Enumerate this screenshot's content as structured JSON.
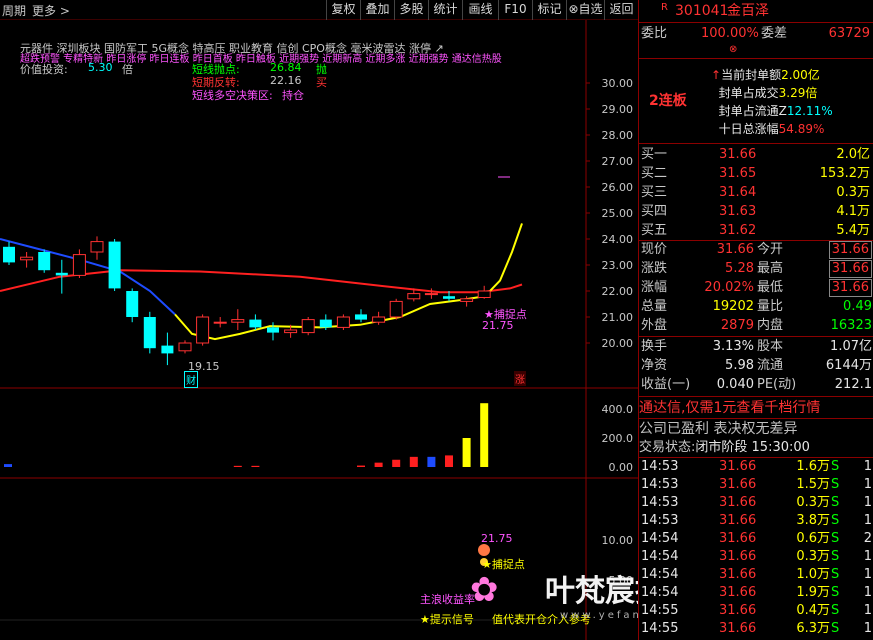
{
  "toolbar": {
    "left_items": [
      "周期",
      "更多 >"
    ],
    "buttons": [
      "复权",
      "叠加",
      "多股",
      "统计",
      "画线",
      "F10",
      "标记",
      "自选",
      "返回"
    ]
  },
  "stock": {
    "code": "301041",
    "name": "金百泽",
    "label_R": "R"
  },
  "chart": {
    "concepts_line": "元器件  深圳板块  国防军工 5G概念 特高压 职业教育 信创 CPO概念 毫米波雷达 涨停  ↗",
    "signals_line": "超跌预警 专精特新 昨日涨停 昨日连板 昨日首板 昨日触板 近期强势 近期新高 近期多涨 近期强势 通达信热股",
    "value_invest_label": "价值投资:",
    "value_invest_value": "5.30",
    "value_invest_unit": "倍",
    "short_sell_label": "短线抛点:",
    "short_sell_value": "26.84",
    "short_sell_action": "抛",
    "short_buy_label": "短期反转:",
    "short_buy_value": "22.16",
    "short_buy_action": "买",
    "decision_label": "短线多空决策区:",
    "decision_value": "持仓",
    "capture_label": "★捕捉点",
    "capture_value": "21.75",
    "low_label": "19.15",
    "cai_badge": "财",
    "zhang_badge": "涨",
    "price_ticks": [
      "30.00",
      "29.00",
      "28.00",
      "27.00",
      "26.00",
      "25.00",
      "24.00",
      "23.00",
      "22.00",
      "21.00",
      "20.00"
    ],
    "vol_ticks": [
      "400.0",
      "200.0",
      "0.00"
    ],
    "ind_ticks": [
      "10.00",
      "5.00"
    ],
    "ind_capture_value": "21.75",
    "ind_capture_label": "★捕捉点",
    "ind_main_label": "主浪收益率",
    "ind_hint_label": "★提示信号",
    "ind_hint_value": "值代表开仓介入参考",
    "watermark": "叶梵宸指标公式网",
    "watermark_url": "www.yefanchen.com",
    "accent_colors": {
      "up": "#ff3232",
      "down": "#00ffff",
      "ma_short": "#ffff00",
      "ma_long": "#ff2020",
      "ma_down": "#1e4cff"
    }
  },
  "right_panel": {
    "weibi_label": "委比",
    "weibi_value": "100.00%",
    "weicha_label": "委差",
    "weicha_value": "63729",
    "board_tag": "2连板",
    "board_info": [
      {
        "label": "当前封单额",
        "value": "2.00亿"
      },
      {
        "label": "封单占成交",
        "value": "3.29倍"
      },
      {
        "label": "封单占流通Z",
        "value": "12.11%"
      },
      {
        "label": "十日总涨幅",
        "value": "54.89%"
      }
    ],
    "buys": [
      {
        "label": "买一",
        "price": "31.66",
        "vol": "2.0亿"
      },
      {
        "label": "买二",
        "price": "31.65",
        "vol": "153.2万"
      },
      {
        "label": "买三",
        "price": "31.64",
        "vol": "0.3万"
      },
      {
        "label": "买四",
        "price": "31.63",
        "vol": "4.1万"
      },
      {
        "label": "买五",
        "price": "31.62",
        "vol": "5.4万"
      }
    ],
    "quote": [
      {
        "l1": "现价",
        "v1": "31.66",
        "l2": "今开",
        "v2": "31.66"
      },
      {
        "l1": "涨跌",
        "v1": "5.28",
        "l2": "最高",
        "v2": "31.66"
      },
      {
        "l1": "涨幅",
        "v1": "20.02%",
        "l2": "最低",
        "v2": "31.66"
      },
      {
        "l1": "总量",
        "v1": "19202",
        "l2": "量比",
        "v2": "0.49"
      },
      {
        "l1": "外盘",
        "v1": "2879",
        "l2": "内盘",
        "v2": "16323"
      }
    ],
    "fund": [
      {
        "l1": "换手",
        "v1": "3.13%",
        "l2": "股本",
        "v2": "1.07亿"
      },
      {
        "l1": "净资",
        "v1": "5.98",
        "l2": "流通",
        "v2": "6144万"
      },
      {
        "l1": "收益(一)",
        "v1": "0.040",
        "l2": "PE(动)",
        "v2": "212.1"
      }
    ],
    "ad_text": "通达信,仅需1元查看千档行情",
    "news_text": "公司已盈利 表决权无差异",
    "status_label": "交易状态:",
    "status_value": "闭市阶段 15:30:00",
    "ticks": [
      {
        "t": "14:53",
        "p": "31.66",
        "v": "1.6万",
        "s": "S",
        "n": "1"
      },
      {
        "t": "14:53",
        "p": "31.66",
        "v": "1.5万",
        "s": "S",
        "n": "1"
      },
      {
        "t": "14:53",
        "p": "31.66",
        "v": "0.3万",
        "s": "S",
        "n": "1"
      },
      {
        "t": "14:53",
        "p": "31.66",
        "v": "3.8万",
        "s": "S",
        "n": "1"
      },
      {
        "t": "14:54",
        "p": "31.66",
        "v": "0.6万",
        "s": "S",
        "n": "2"
      },
      {
        "t": "14:54",
        "p": "31.66",
        "v": "0.3万",
        "s": "S",
        "n": "1"
      },
      {
        "t": "14:54",
        "p": "31.66",
        "v": "1.0万",
        "s": "S",
        "n": "1"
      },
      {
        "t": "14:54",
        "p": "31.66",
        "v": "1.9万",
        "s": "S",
        "n": "1"
      },
      {
        "t": "14:55",
        "p": "31.66",
        "v": "0.4万",
        "s": "S",
        "n": "1"
      },
      {
        "t": "14:55",
        "p": "31.66",
        "v": "6.3万",
        "s": "S",
        "n": "1"
      }
    ]
  },
  "candles": [
    {
      "o": 23.7,
      "h": 23.9,
      "l": 23.0,
      "c": 23.1
    },
    {
      "o": 23.2,
      "h": 23.5,
      "l": 22.9,
      "c": 23.3
    },
    {
      "o": 23.5,
      "h": 23.6,
      "l": 22.7,
      "c": 22.8
    },
    {
      "o": 22.7,
      "h": 23.2,
      "l": 21.9,
      "c": 22.6
    },
    {
      "o": 22.6,
      "h": 23.6,
      "l": 22.5,
      "c": 23.4
    },
    {
      "o": 23.5,
      "h": 24.1,
      "l": 23.2,
      "c": 23.9
    },
    {
      "o": 23.9,
      "h": 24.0,
      "l": 22.0,
      "c": 22.1
    },
    {
      "o": 22.0,
      "h": 22.1,
      "l": 20.8,
      "c": 21.0
    },
    {
      "o": 21.0,
      "h": 21.2,
      "l": 19.6,
      "c": 19.8
    },
    {
      "o": 19.9,
      "h": 20.4,
      "l": 19.15,
      "c": 19.6
    },
    {
      "o": 19.7,
      "h": 20.1,
      "l": 19.6,
      "c": 20.0
    },
    {
      "o": 20.0,
      "h": 21.1,
      "l": 19.9,
      "c": 21.0
    },
    {
      "o": 20.8,
      "h": 21.0,
      "l": 20.6,
      "c": 20.8
    },
    {
      "o": 20.8,
      "h": 21.3,
      "l": 20.5,
      "c": 20.9
    },
    {
      "o": 20.9,
      "h": 21.1,
      "l": 20.5,
      "c": 20.6
    },
    {
      "o": 20.6,
      "h": 20.8,
      "l": 20.1,
      "c": 20.4
    },
    {
      "o": 20.4,
      "h": 20.7,
      "l": 20.2,
      "c": 20.5
    },
    {
      "o": 20.4,
      "h": 21.0,
      "l": 20.3,
      "c": 20.9
    },
    {
      "o": 20.9,
      "h": 21.1,
      "l": 20.5,
      "c": 20.6
    },
    {
      "o": 20.6,
      "h": 21.1,
      "l": 20.5,
      "c": 21.0
    },
    {
      "o": 21.1,
      "h": 21.3,
      "l": 20.8,
      "c": 20.9
    },
    {
      "o": 20.8,
      "h": 21.2,
      "l": 20.7,
      "c": 21.0
    },
    {
      "o": 21.0,
      "h": 21.7,
      "l": 20.9,
      "c": 21.6
    },
    {
      "o": 21.7,
      "h": 22.1,
      "l": 21.6,
      "c": 21.9
    },
    {
      "o": 21.9,
      "h": 22.1,
      "l": 21.7,
      "c": 21.9
    },
    {
      "o": 21.8,
      "h": 22.0,
      "l": 21.6,
      "c": 21.7
    },
    {
      "o": 21.6,
      "h": 21.8,
      "l": 21.4,
      "c": 21.7
    },
    {
      "o": 21.75,
      "h": 22.2,
      "l": 21.7,
      "c": 22.0
    }
  ],
  "volumes": [
    {
      "v": 20,
      "up": false
    },
    {
      "v": 0,
      "up": false
    },
    {
      "v": 0,
      "up": false
    },
    {
      "v": 0,
      "up": false
    },
    {
      "v": 0,
      "up": false
    },
    {
      "v": 0,
      "up": false
    },
    {
      "v": 0,
      "up": false
    },
    {
      "v": 0,
      "up": false
    },
    {
      "v": 0,
      "up": false
    },
    {
      "v": 0,
      "up": false
    },
    {
      "v": 0,
      "up": false
    },
    {
      "v": 0,
      "up": false
    },
    {
      "v": 0,
      "up": false
    },
    {
      "v": 0,
      "up": false
    },
    {
      "v": 8,
      "up": true
    },
    {
      "v": 8,
      "up": true
    },
    {
      "v": 0,
      "up": false
    },
    {
      "v": 0,
      "up": false
    },
    {
      "v": 0,
      "up": false
    },
    {
      "v": 0,
      "up": false
    },
    {
      "v": 0,
      "up": false
    },
    {
      "v": 10,
      "up": true
    },
    {
      "v": 30,
      "up": true
    },
    {
      "v": 50,
      "up": true
    },
    {
      "v": 70,
      "up": true
    },
    {
      "v": 70,
      "up": false
    },
    {
      "v": 80,
      "up": true
    },
    {
      "v": 200,
      "up": true
    },
    {
      "v": 440,
      "up": true
    }
  ]
}
